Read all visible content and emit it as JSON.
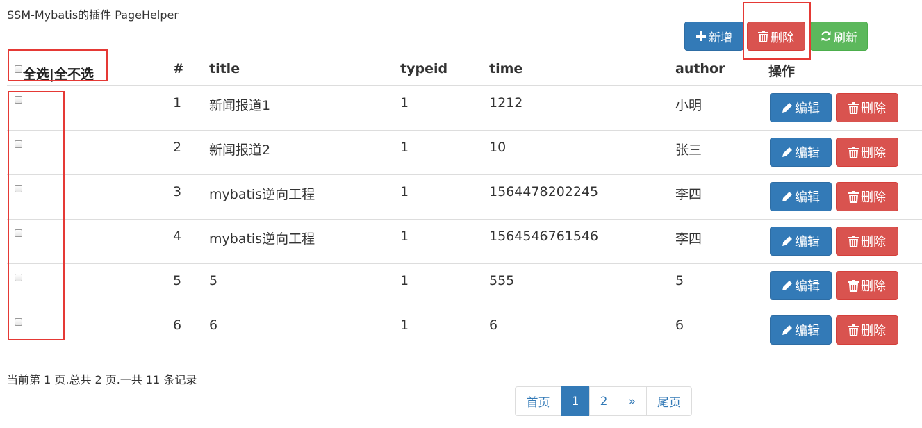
{
  "page": {
    "title": "SSM-Mybatis的插件 PageHelper"
  },
  "toolbar": {
    "add_label": "新增",
    "delete_label": "删除",
    "refresh_label": "刷新"
  },
  "table": {
    "select_all_label": "全选|全不选",
    "headers": {
      "num": "#",
      "title": "title",
      "typeid": "typeid",
      "time": "time",
      "author": "author",
      "ops": "操作"
    },
    "rows": [
      {
        "num": "1",
        "title": "新闻报道1",
        "typeid": "1",
        "time": "1212",
        "author": "小明"
      },
      {
        "num": "2",
        "title": "新闻报道2",
        "typeid": "1",
        "time": "10",
        "author": "张三"
      },
      {
        "num": "3",
        "title": "mybatis逆向工程",
        "typeid": "1",
        "time": "1564478202245",
        "author": "李四"
      },
      {
        "num": "4",
        "title": "mybatis逆向工程",
        "typeid": "1",
        "time": "1564546761546",
        "author": "李四"
      },
      {
        "num": "5",
        "title": "5",
        "typeid": "1",
        "time": "555",
        "author": "5"
      },
      {
        "num": "6",
        "title": "6",
        "typeid": "1",
        "time": "6",
        "author": "6"
      }
    ],
    "row_actions": {
      "edit_label": "编辑",
      "delete_label": "删除"
    }
  },
  "footer": {
    "summary": "当前第 1 页.总共 2 页.一共 11 条记录"
  },
  "pagination": {
    "first": "首页",
    "page1": "1",
    "page2": "2",
    "next": "»",
    "last": "尾页",
    "current_page": 1
  },
  "icons": {
    "add": "plus-icon",
    "delete": "trash-icon",
    "refresh": "refresh-icon",
    "edit": "pencil-icon"
  },
  "colors": {
    "primary": "#337ab7",
    "danger": "#d9534f",
    "success": "#5cb85c",
    "highlight": "#e53935"
  }
}
